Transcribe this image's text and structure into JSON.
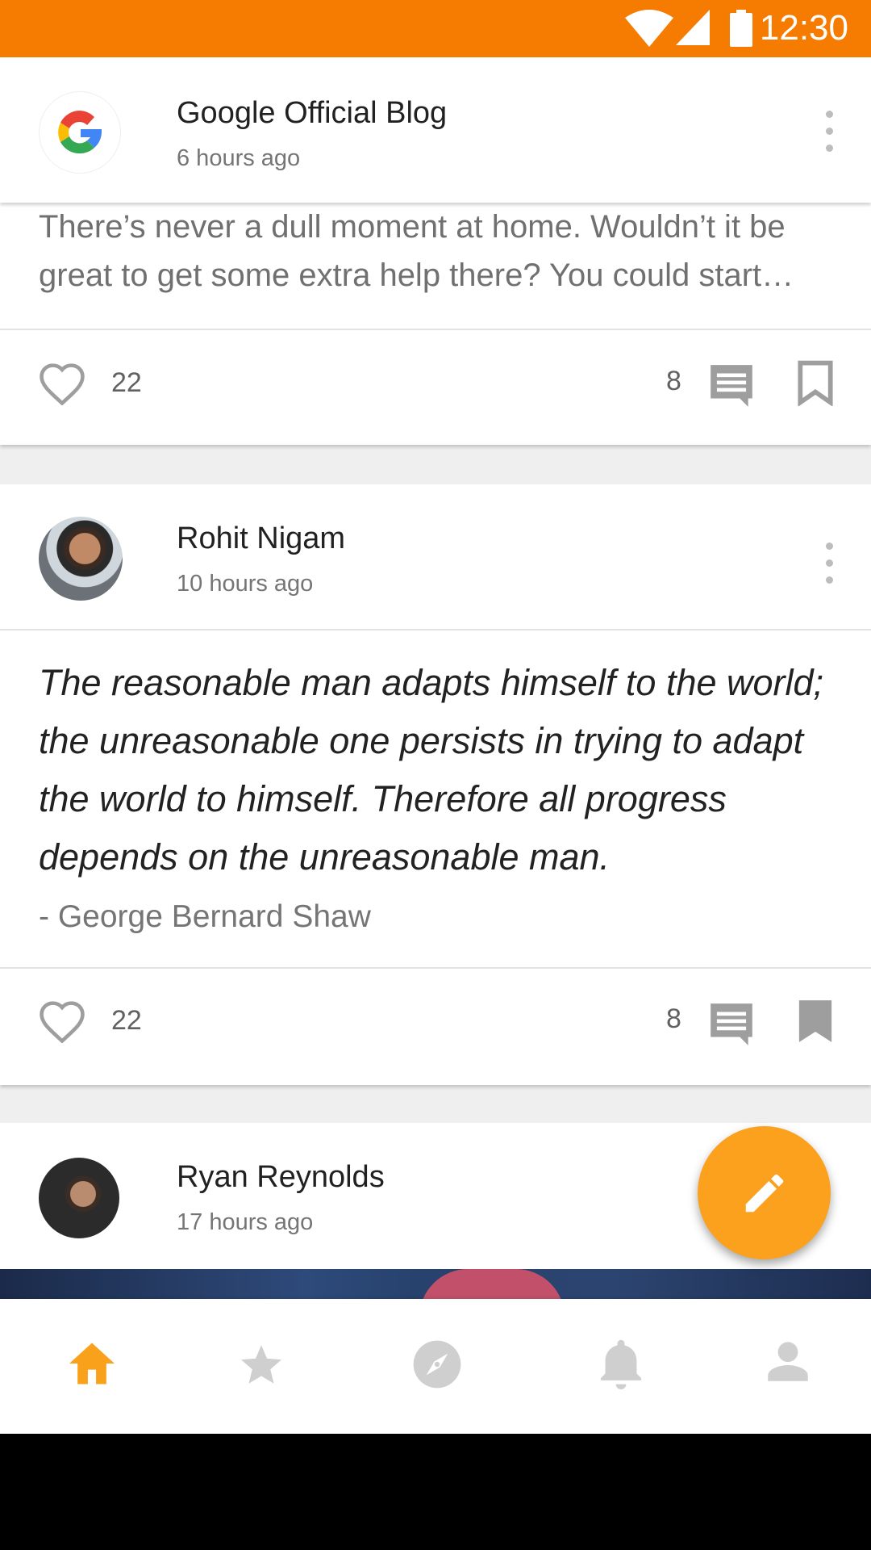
{
  "status_bar": {
    "time": "12:30"
  },
  "colors": {
    "accent": "#f57c00",
    "fab": "#fba11e",
    "icon_gray": "#9e9e9e",
    "nav_active": "#f9a11b"
  },
  "posts": [
    {
      "author": "Google Official Blog",
      "time_ago": "6 hours ago",
      "snippet": "There’s never a dull moment at home. Wouldn’t it be great to get some extra help there? You could start…",
      "likes": "22",
      "comments": "8",
      "bookmarked": false
    },
    {
      "author": "Rohit Nigam",
      "time_ago": "10 hours ago",
      "quote": "The reasonable man adapts himself to the world; the unreasonable one persists in trying to adapt the world to himself. Therefore all progress depends on the unreasonable man.",
      "quote_author": "- George Bernard Shaw",
      "likes": "22",
      "comments": "8",
      "bookmarked": true
    },
    {
      "author": "Ryan Reynolds",
      "time_ago": "17 hours ago"
    }
  ],
  "fab": {
    "icon": "pencil-icon"
  },
  "bottom_nav": [
    {
      "icon": "home-icon",
      "active": true
    },
    {
      "icon": "star-icon",
      "active": false
    },
    {
      "icon": "compass-icon",
      "active": false
    },
    {
      "icon": "bell-icon",
      "active": false
    },
    {
      "icon": "person-icon",
      "active": false
    }
  ]
}
